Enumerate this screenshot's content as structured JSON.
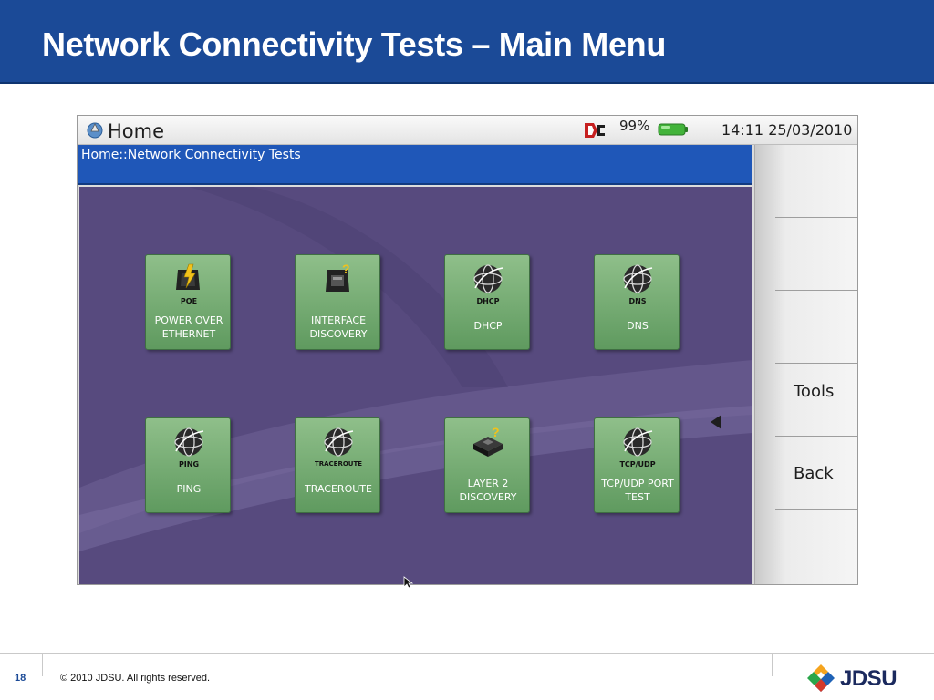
{
  "slide": {
    "title": "Network Connectivity Tests – Main Menu",
    "page_number": "18",
    "copyright": "© 2010 JDSU. All rights reserved.",
    "brand": "JDSU"
  },
  "device": {
    "statusbar": {
      "title": "Home",
      "battery_percent": "99%",
      "datetime": "14:11  25/03/2010",
      "icons": [
        "home-icon",
        "dc-power-icon",
        "battery-icon"
      ]
    },
    "breadcrumb": {
      "home": "Home",
      "separator": "::",
      "current": "Network Connectivity Tests"
    },
    "tiles": [
      {
        "id": "poe",
        "tag": "POE",
        "label": "POWER OVER ETHERNET",
        "icon": "poe-icon"
      },
      {
        "id": "interface-discovery",
        "tag": "",
        "label": "INTERFACE DISCOVERY",
        "icon": "interface-discovery-icon"
      },
      {
        "id": "dhcp",
        "tag": "DHCP",
        "label": "DHCP",
        "icon": "globe-icon"
      },
      {
        "id": "dns",
        "tag": "DNS",
        "label": "DNS",
        "icon": "globe-icon"
      },
      {
        "id": "ping",
        "tag": "PING",
        "label": "PING",
        "icon": "globe-icon"
      },
      {
        "id": "traceroute",
        "tag": "TRACEROUTE",
        "label": "TRACEROUTE",
        "icon": "globe-icon"
      },
      {
        "id": "layer2-discovery",
        "tag": "",
        "label": "LAYER 2 DISCOVERY",
        "icon": "layer2-discovery-icon"
      },
      {
        "id": "tcp-udp-port-test",
        "tag": "TCP/UDP",
        "label": "TCP/UDP PORT TEST",
        "icon": "globe-icon"
      }
    ],
    "softkeys": {
      "tools": "Tools",
      "back": "Back"
    }
  },
  "colors": {
    "title_bar": "#1b4a97",
    "breadcrumb_bar": "#1f57b8",
    "panel_bg": "#574a7e",
    "tile_green": "#6fa86d"
  }
}
